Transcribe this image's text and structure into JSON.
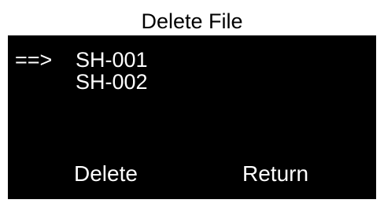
{
  "screen": {
    "title": "Delete File",
    "cursor": "==>",
    "files": [
      {
        "name": "SH-001",
        "selected": true
      },
      {
        "name": "SH-002",
        "selected": false
      }
    ],
    "softkeys": {
      "delete_label": "Delete",
      "return_label": "Return"
    }
  },
  "colors": {
    "background": "#000000",
    "foreground": "#ffffff",
    "title_background": "#ffffff",
    "title_text": "#000000"
  }
}
